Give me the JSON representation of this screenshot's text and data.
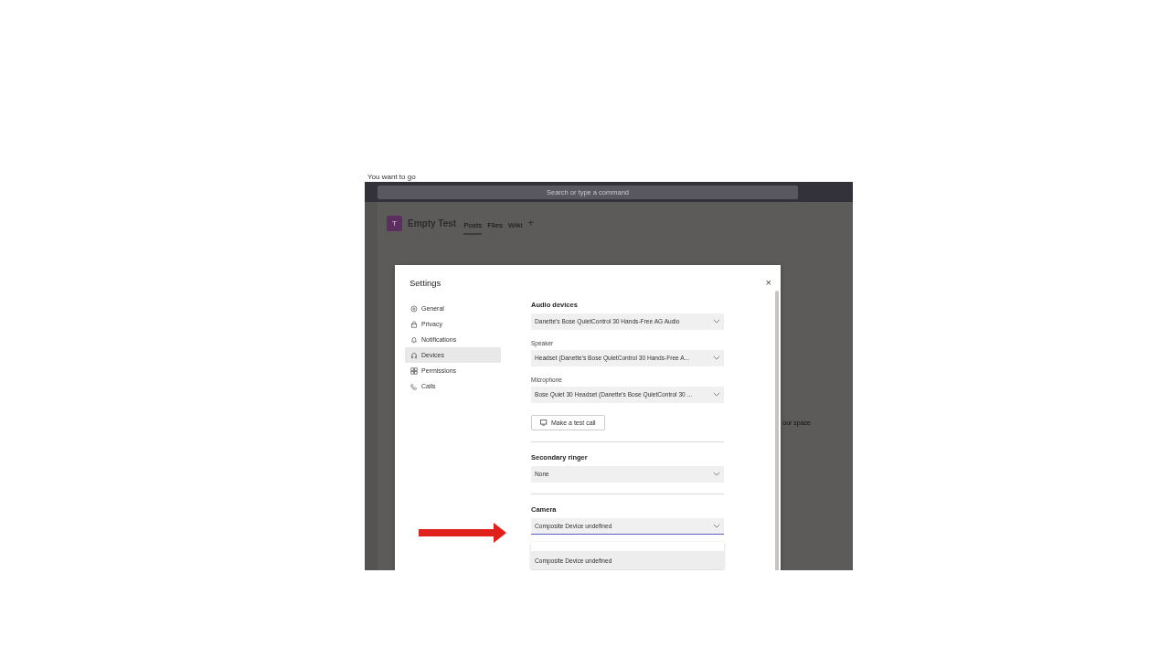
{
  "app": {
    "top_text": "You want to go",
    "search": {
      "placeholder": "Search or type a command"
    },
    "team": {
      "avatar": "T",
      "name": "Empty Test"
    },
    "tabs": [
      {
        "label": "Posts",
        "selected": true
      },
      {
        "label": "Files",
        "selected": false
      },
      {
        "label": "Wiki",
        "selected": false
      }
    ],
    "add_tab": "+",
    "side_text": "our space"
  },
  "dialog": {
    "title": "Settings",
    "close": "×",
    "nav": [
      {
        "label": "General",
        "kind": "gear",
        "selected": false
      },
      {
        "label": "Privacy",
        "kind": "lock",
        "selected": false
      },
      {
        "label": "Notifications",
        "kind": "bell",
        "selected": false
      },
      {
        "label": "Devices",
        "kind": "headset",
        "selected": true
      },
      {
        "label": "Permissions",
        "kind": "grid",
        "selected": false
      },
      {
        "label": "Calls",
        "kind": "phone",
        "selected": false
      }
    ],
    "sections": [
      {
        "heading": "Audio devices",
        "fields": [
          {
            "value": "Danette's Bose QuietControl 30 Hands-Free AG Audio",
            "focused": false
          },
          {
            "label": "Speaker",
            "value": "Headset (Danette's Bose QuietControl 30 Hands-Free A...",
            "focused": false
          },
          {
            "label": "Microphone",
            "value": "Bose Quiet 30 Headset (Danette's Bose QuietControl 30 ...",
            "focused": false
          }
        ],
        "button": "Make a test call"
      },
      {
        "heading": "Secondary ringer",
        "fields": [
          {
            "value": "None",
            "focused": false
          }
        ]
      },
      {
        "heading": "Camera",
        "fields": [
          {
            "value": "Composite Device undefined",
            "focused": true
          }
        ],
        "options": [
          {
            "label": "Composite Device undefined",
            "selected": true
          }
        ]
      }
    ]
  }
}
